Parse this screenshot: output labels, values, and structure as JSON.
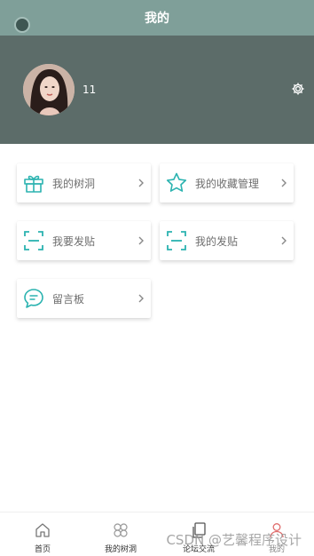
{
  "header": {
    "title": "我的"
  },
  "profile": {
    "username": "11"
  },
  "menu": [
    {
      "label": "我的树洞",
      "icon": "gift-icon"
    },
    {
      "label": "我的收藏管理",
      "icon": "star-icon"
    },
    {
      "label": "我要发贴",
      "icon": "scan-frame-icon"
    },
    {
      "label": "我的发贴",
      "icon": "scan-frame-icon"
    },
    {
      "label": "留言板",
      "icon": "chat-bubble-icon"
    }
  ],
  "tabbar": {
    "items": [
      {
        "label": "首页",
        "icon": "home-icon"
      },
      {
        "label": "我的树洞",
        "icon": "clover-icon"
      },
      {
        "label": "论坛交流",
        "icon": "copy-icon"
      },
      {
        "label": "我的",
        "icon": "user-icon",
        "active": true
      }
    ]
  },
  "watermark": "CSDN @艺馨程序设计",
  "colors": {
    "topbar": "#7f9f99",
    "profile_bg": "#5c6c69",
    "accent": "#2bb3b0"
  }
}
